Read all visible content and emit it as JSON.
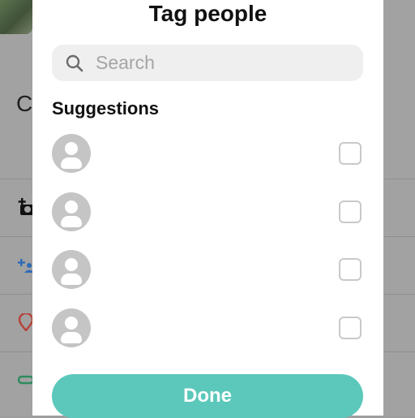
{
  "sheet": {
    "title": "Tag people",
    "search": {
      "placeholder": "Search",
      "value": ""
    },
    "section_title": "Suggestions",
    "suggestions": [
      {
        "name": "",
        "checked": false
      },
      {
        "name": "",
        "checked": false
      },
      {
        "name": "",
        "checked": false
      },
      {
        "name": "",
        "checked": false
      }
    ],
    "done_label": "Done"
  },
  "background": {
    "caption_fragment": "C"
  },
  "colors": {
    "accent": "#5bc8bb",
    "search_bg": "#efefef",
    "avatar_bg": "#c5c5c5",
    "overlay": "#a2a2a2"
  },
  "icons": [
    "search-icon",
    "person-icon",
    "add-photo-icon",
    "add-people-icon",
    "location-icon",
    "link-icon"
  ]
}
